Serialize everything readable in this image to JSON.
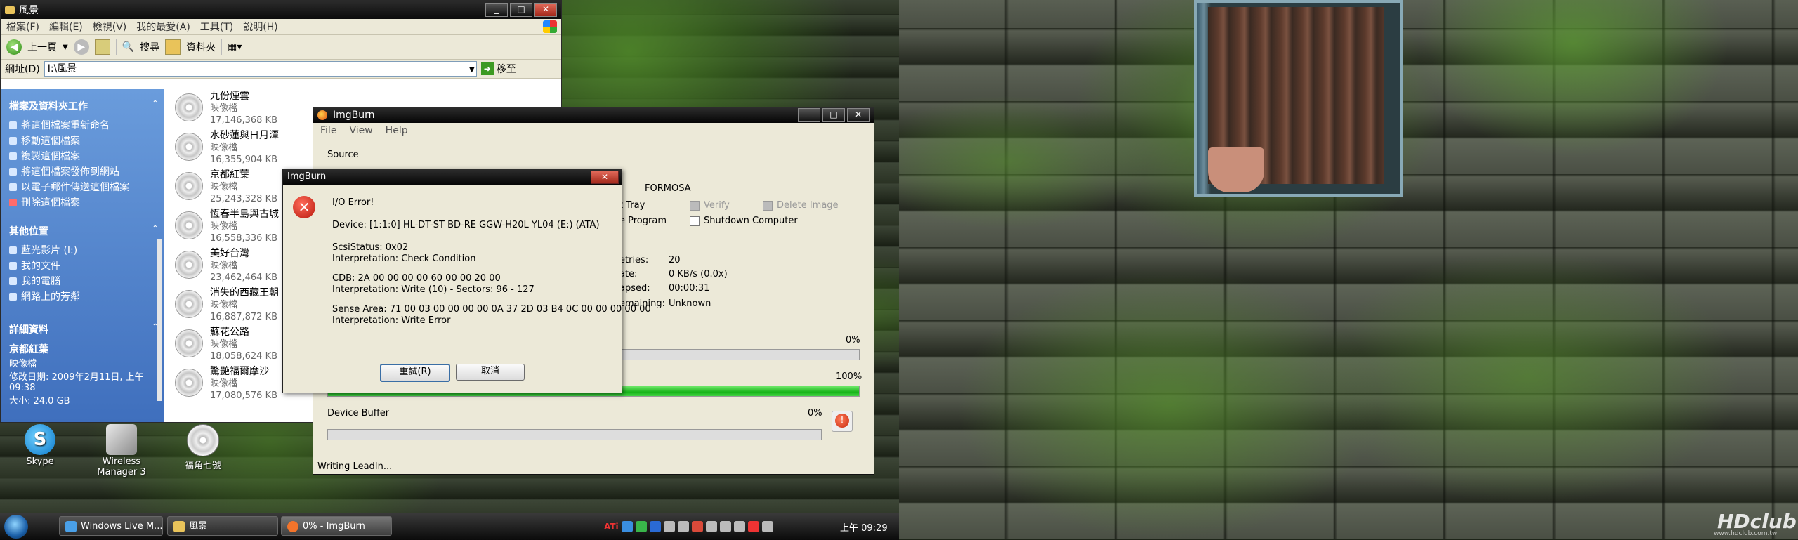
{
  "explorer": {
    "title": "風景",
    "menu": [
      "檔案(F)",
      "編輯(E)",
      "檢視(V)",
      "我的最愛(A)",
      "工具(T)",
      "說明(H)"
    ],
    "toolbar": {
      "back": "上一頁",
      "search": "搜尋",
      "folders": "資料夾"
    },
    "address_label": "網址(D)",
    "address_value": "I:\\風景",
    "go_label": "移至",
    "tasks_header": "檔案及資料夾工作",
    "tasks": [
      "將這個檔案重新命名",
      "移動這個檔案",
      "複製這個檔案",
      "將這個檔案發佈到網站",
      "以電子郵件傳送這個檔案",
      "刪除這個檔案"
    ],
    "places_header": "其他位置",
    "places": [
      "藍光影片 (I:)",
      "我的文件",
      "我的電腦",
      "網路上的芳鄰"
    ],
    "details_header": "詳細資料",
    "details": {
      "name": "京都紅葉",
      "type": "映像檔",
      "modified": "修改日期: 2009年2月11日, 上午 09:38",
      "size": "大小: 24.0 GB"
    },
    "files": [
      {
        "name": "九份煙雲",
        "type": "映像檔",
        "size": "17,146,368 KB"
      },
      {
        "name": "水砂蓮與日月潭",
        "type": "映像檔",
        "size": "16,355,904 KB"
      },
      {
        "name": "京都紅葉",
        "type": "映像檔",
        "size": "25,243,328 KB"
      },
      {
        "name": "恆春半島與古城",
        "type": "映像檔",
        "size": "16,558,336 KB"
      },
      {
        "name": "美好台灣",
        "type": "映像檔",
        "size": "23,462,464 KB"
      },
      {
        "name": "消失的西藏王朝",
        "type": "映像檔",
        "size": "16,887,872 KB"
      },
      {
        "name": "蘇花公路",
        "type": "映像檔",
        "size": "18,058,624 KB"
      },
      {
        "name": "驚艷福爾摩沙",
        "type": "映像檔",
        "size": "17,080,576 KB"
      }
    ]
  },
  "desktop_icons": [
    "Skype",
    "Wireless Manager 3",
    "福角七號"
  ],
  "imgburn": {
    "title": "ImgBurn",
    "menu": [
      "File",
      "View",
      "Help"
    ],
    "source_label": "Source",
    "formosa": "FORMOSA",
    "options": [
      {
        "label": "t Tray",
        "disabled": false
      },
      {
        "label": "Verify",
        "disabled": true
      },
      {
        "label": "Delete Image",
        "disabled": true
      },
      {
        "label": "e Program",
        "disabled": false
      },
      {
        "label": "Shutdown Computer",
        "disabled": false
      }
    ],
    "stats": [
      {
        "label": "etries:",
        "value": "20"
      },
      {
        "label": "ate:",
        "value": "0 KB/s (0.0x)"
      },
      {
        "label": "apsed:",
        "value": "00:00:31"
      },
      {
        "label": "emaining:",
        "value": "Unknown"
      }
    ],
    "progress1": {
      "label": "0%",
      "value": 0
    },
    "progress2": {
      "label": "100%",
      "value": 100
    },
    "buffer_label": "Device Buffer",
    "buffer": {
      "label": "0%",
      "value": 0
    },
    "status": "Writing LeadIn..."
  },
  "error_dialog": {
    "title": "ImgBurn",
    "lines": [
      "I/O Error!",
      "Device: [1:1:0] HL-DT-ST BD-RE  GGW-H20L YL04 (E:) (ATA)",
      "ScsiStatus: 0x02",
      "Interpretation: Check Condition",
      "CDB: 2A 00 00 00 00 60 00 00 20 00",
      "Interpretation: Write (10) - Sectors: 96 - 127",
      "Sense Area: 71 00 03 00 00 00 00 0A 37 2D 03 B4 0C 00 00 00 00 00",
      "Interpretation: Write Error"
    ],
    "retry_label": "重試(R)",
    "cancel_label": "取消"
  },
  "taskbar": {
    "buttons": [
      "Windows Live M...",
      "風景",
      "0% - ImgBurn"
    ],
    "tray_ati": "ATi",
    "clock": "上午 09:29"
  },
  "watermark": {
    "text": "HDclub",
    "sub": "www.hdclub.com.tw"
  }
}
